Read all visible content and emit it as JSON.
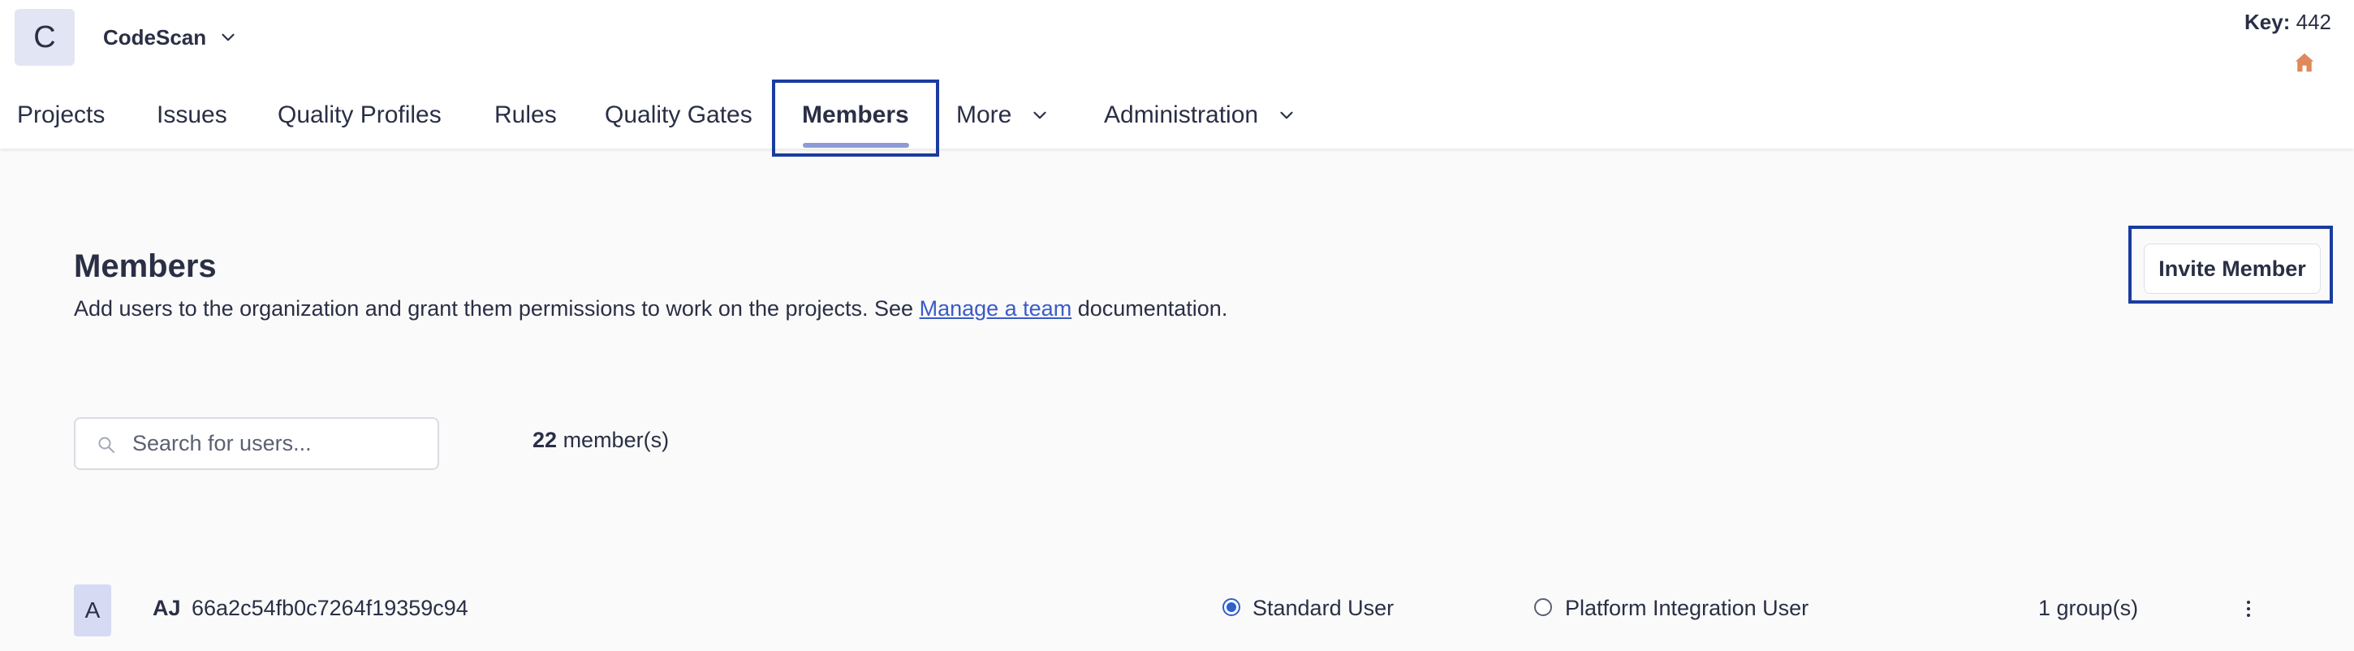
{
  "org": {
    "initial": "C",
    "name": "CodeScan"
  },
  "key_info": {
    "label": "Key:",
    "value": "442"
  },
  "nav": {
    "items": [
      {
        "label": "Projects"
      },
      {
        "label": "Issues"
      },
      {
        "label": "Quality Profiles"
      },
      {
        "label": "Rules"
      },
      {
        "label": "Quality Gates"
      },
      {
        "label": "Members",
        "active": true
      },
      {
        "label": "More",
        "has_dropdown": true
      },
      {
        "label": "Administration",
        "has_dropdown": true
      }
    ]
  },
  "page": {
    "title": "Members",
    "description_prefix": "Add users to the organization and grant them permissions to work on the projects. See ",
    "description_link": "Manage a team",
    "description_suffix": " documentation.",
    "invite_button": "Invite Member"
  },
  "search": {
    "placeholder": "Search for users...",
    "value": ""
  },
  "member_count": {
    "count": "22",
    "label": "member(s)"
  },
  "members": [
    {
      "avatar": "A",
      "initials": "AJ",
      "id": "66a2c54fb0c7264f19359c94",
      "role_options": [
        {
          "label": "Standard User",
          "selected": true
        },
        {
          "label": "Platform Integration User",
          "selected": false
        }
      ],
      "groups": "1 group(s)"
    }
  ],
  "colors": {
    "accent": "#2f5fd0",
    "highlight_border": "#1a3ba0",
    "link": "#3a5bc7",
    "home_icon": "#e0885a"
  },
  "icons": [
    "chevron-down-icon",
    "home-icon",
    "search-icon",
    "more-vertical-icon"
  ]
}
